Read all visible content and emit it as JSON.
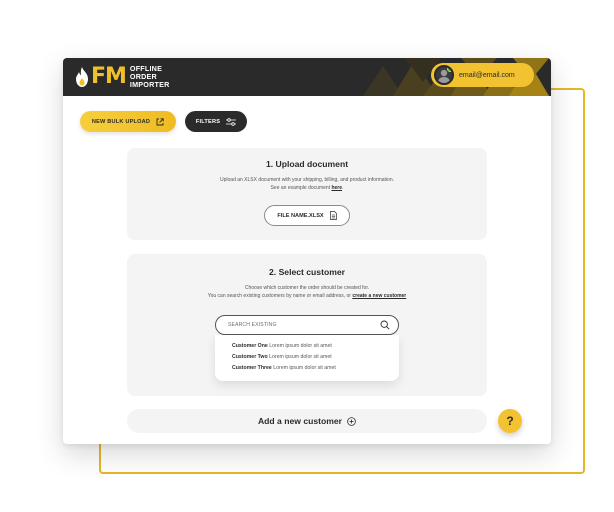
{
  "brand": {
    "logo_letters": "FM",
    "logo_line1": "OFFLINE",
    "logo_line2": "ORDER",
    "logo_line3": "IMPORTER"
  },
  "header": {
    "user_email": "email@email.com"
  },
  "toolbar": {
    "new_bulk_upload_label": "NEW BULK UPLOAD",
    "filters_label": "FILTERS"
  },
  "upload": {
    "title": "1. Upload document",
    "desc_line1": "Upload an XLSX document with your shipping, billing, and product information.",
    "desc_line2_prefix": "See an example document ",
    "desc_link": "here",
    "desc_line2_suffix": ".",
    "file_button_label": "FILE NAME.XLSX"
  },
  "customer": {
    "title": "2. Select customer",
    "desc_line1": "Choose which customer the order should be created for.",
    "desc_line2_prefix": "You can search existing customers by name or email address, or ",
    "desc_link": "create a new customer",
    "search_placeholder": "SEARCH EXISTING",
    "results": [
      {
        "name": "Customer One",
        "detail": "Lorem ipsum dolor sit amet"
      },
      {
        "name": "Customer Two",
        "detail": "Lorem ipsum dolor sit amet"
      },
      {
        "name": "Customer Three",
        "detail": "Lorem ipsum dolor sit amet"
      }
    ]
  },
  "add_customer": {
    "label": "Add a new customer"
  },
  "help": {
    "label": "?"
  },
  "colors": {
    "accent": "#f2c230",
    "dark": "#2a2a2a",
    "panel": "#f4f4f4",
    "frame": "#e4b62a"
  },
  "icons": [
    "flame-icon",
    "external-link-icon",
    "sliders-icon",
    "document-icon",
    "search-icon",
    "plus-circle-icon"
  ]
}
